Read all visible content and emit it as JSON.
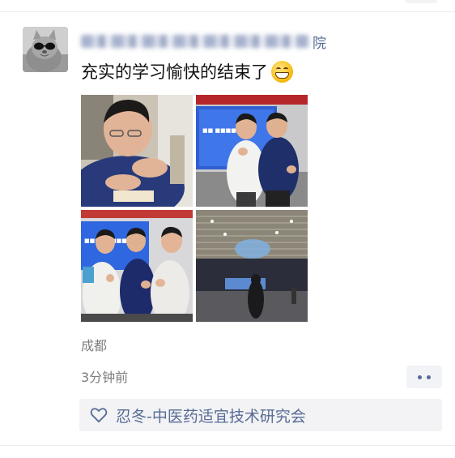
{
  "post": {
    "author_tail": "院",
    "text": "充实的学习愉快的结束了",
    "emoji": "grinning-face-emoji",
    "photos": [
      {
        "name": "photo-1",
        "description_icon": "photo"
      },
      {
        "name": "photo-2",
        "description_icon": "photo"
      },
      {
        "name": "photo-3",
        "description_icon": "photo"
      },
      {
        "name": "photo-4",
        "description_icon": "photo"
      }
    ],
    "location": "成都",
    "time": "3分钟前"
  },
  "likes": {
    "icon": "heart-icon",
    "names": "忍冬-中医药适宜技术研究会"
  },
  "colors": {
    "link": "#576b95",
    "meta": "#7d7d7d",
    "text": "#111111",
    "panel": "#f3f3f5"
  }
}
